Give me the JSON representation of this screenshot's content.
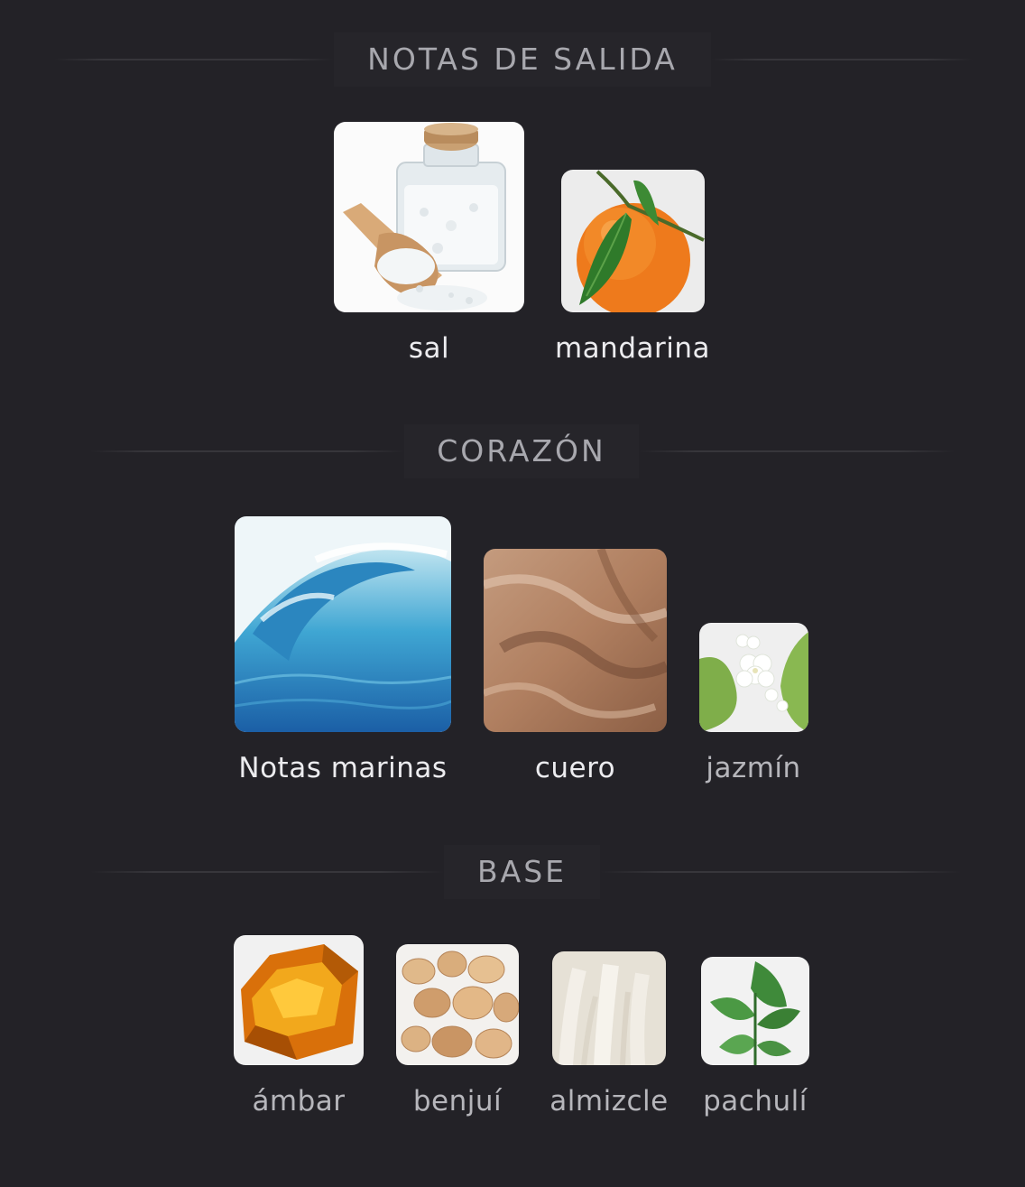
{
  "sections": [
    {
      "title": "NOTAS DE SALIDA",
      "notes": [
        {
          "label": "sal",
          "image": "salt-jar-image"
        },
        {
          "label": "mandarina",
          "image": "mandarin-image"
        }
      ]
    },
    {
      "title": "CORAZÓN",
      "notes": [
        {
          "label": "Notas marinas",
          "image": "ocean-wave-image"
        },
        {
          "label": "cuero",
          "image": "leather-image"
        },
        {
          "label": "jazmín",
          "image": "jasmine-image"
        }
      ]
    },
    {
      "title": "BASE",
      "notes": [
        {
          "label": "ámbar",
          "image": "amber-image"
        },
        {
          "label": "benjuí",
          "image": "benzoin-image"
        },
        {
          "label": "almizcle",
          "image": "musk-image"
        },
        {
          "label": "pachulí",
          "image": "patchouli-image"
        }
      ]
    }
  ],
  "colors": {
    "background": "#232227",
    "header_text": "#a8a8ae",
    "label_text": "#ececef"
  }
}
